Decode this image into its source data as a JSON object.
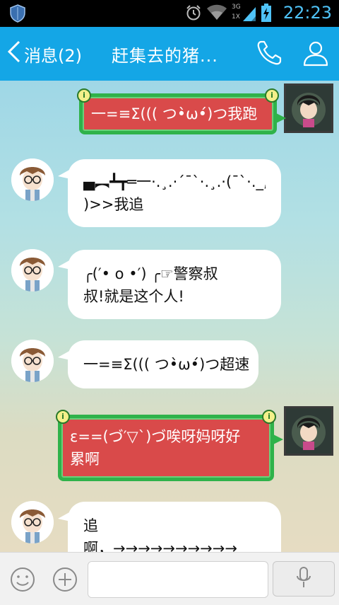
{
  "status_bar": {
    "time": "22:23",
    "network_label": "3G",
    "signal_sub": "1X",
    "icons": [
      "shield-icon",
      "alarm-icon",
      "wifi-icon",
      "signal-icon",
      "battery-charging-icon"
    ]
  },
  "header": {
    "back_label": "消息(2)",
    "title": "赶集去的猪...",
    "icons": [
      "back-chevron-icon",
      "phone-icon",
      "profile-icon"
    ]
  },
  "messages": [
    {
      "side": "right",
      "text": "一=≡Σ((( つ•̀ω•́)つ我跑"
    },
    {
      "side": "left",
      "line1": "▄︻┻┳═一·.¸.·´¯`·.¸.·(¯`·._,¯`·",
      "line2": ")>>我追"
    },
    {
      "side": "left",
      "line1": "╭(′• o •′) ╭☞警察叔",
      "line2": "叔!就是这个人!"
    },
    {
      "side": "left",
      "text": "一=≡Σ((( つ•̀ω•́)つ超速"
    },
    {
      "side": "right",
      "line1": "ε==(づ′▽`)づ唉呀妈呀好",
      "line2": "累啊"
    },
    {
      "side": "left",
      "line1": "追",
      "line2": "啊，→→→→→→→→→→"
    }
  ],
  "input_bar": {
    "placeholder": "",
    "icons": [
      "emoji-icon",
      "plus-icon",
      "microphone-icon"
    ]
  },
  "colors": {
    "header_bg": "#14a6e6",
    "bubble_right_bg": "#d94a4a",
    "bubble_right_border": "#2fb24a",
    "bubble_left_bg": "#ffffff"
  }
}
